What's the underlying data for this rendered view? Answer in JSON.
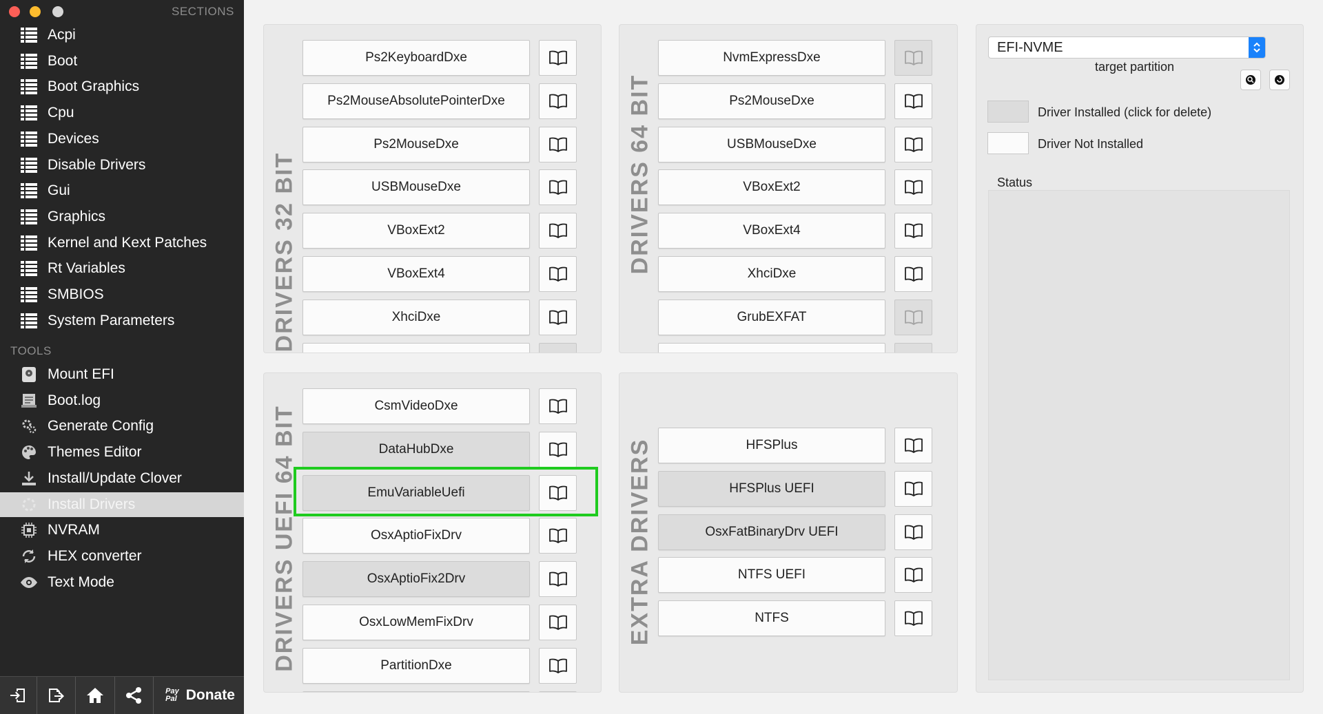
{
  "sidebar": {
    "sections_title": "SECTIONS",
    "sections": [
      {
        "label": "Acpi",
        "icon": "list-icon"
      },
      {
        "label": "Boot",
        "icon": "list-icon"
      },
      {
        "label": "Boot Graphics",
        "icon": "list-icon"
      },
      {
        "label": "Cpu",
        "icon": "list-icon"
      },
      {
        "label": "Devices",
        "icon": "list-icon"
      },
      {
        "label": "Disable Drivers",
        "icon": "list-icon"
      },
      {
        "label": "Gui",
        "icon": "list-icon"
      },
      {
        "label": "Graphics",
        "icon": "list-icon"
      },
      {
        "label": "Kernel and Kext Patches",
        "icon": "list-icon"
      },
      {
        "label": "Rt Variables",
        "icon": "list-icon"
      },
      {
        "label": "SMBIOS",
        "icon": "list-icon"
      },
      {
        "label": "System Parameters",
        "icon": "list-icon"
      }
    ],
    "tools_title": "TOOLS",
    "tools": [
      {
        "label": "Mount EFI",
        "icon": "disk-icon"
      },
      {
        "label": "Boot.log",
        "icon": "log-icon"
      },
      {
        "label": "Generate Config",
        "icon": "gear-icon"
      },
      {
        "label": "Themes Editor",
        "icon": "palette-icon"
      },
      {
        "label": "Install/Update Clover",
        "icon": "download-icon"
      },
      {
        "label": "Install Drivers",
        "icon": "drivers-icon",
        "selected": true
      },
      {
        "label": "NVRAM",
        "icon": "chip-icon"
      },
      {
        "label": "HEX converter",
        "icon": "refresh-icon"
      },
      {
        "label": "Text Mode",
        "icon": "eye-icon"
      }
    ],
    "bottom": {
      "donate_label": "Donate",
      "paypal_line1": "Pay",
      "paypal_line2": "Pal"
    }
  },
  "panels": {
    "drivers32": {
      "title": "DRIVERS 32 BIT",
      "items": [
        {
          "label": "Ps2KeyboardDxe",
          "installed": false,
          "doc": true
        },
        {
          "label": "Ps2MouseAbsolutePointerDxe",
          "installed": false,
          "doc": true
        },
        {
          "label": "Ps2MouseDxe",
          "installed": false,
          "doc": true
        },
        {
          "label": "USBMouseDxe",
          "installed": false,
          "doc": true
        },
        {
          "label": "VBoxExt2",
          "installed": false,
          "doc": true
        },
        {
          "label": "VBoxExt4",
          "installed": false,
          "doc": true
        },
        {
          "label": "XhciDxe",
          "installed": false,
          "doc": true
        }
      ]
    },
    "drivers64": {
      "title": "DRIVERS 64 BIT",
      "items": [
        {
          "label": "NvmExpressDxe",
          "installed": false,
          "doc": false
        },
        {
          "label": "Ps2MouseDxe",
          "installed": false,
          "doc": true
        },
        {
          "label": "USBMouseDxe",
          "installed": false,
          "doc": true
        },
        {
          "label": "VBoxExt2",
          "installed": false,
          "doc": true
        },
        {
          "label": "VBoxExt4",
          "installed": false,
          "doc": true
        },
        {
          "label": "XhciDxe",
          "installed": false,
          "doc": true
        },
        {
          "label": "GrubEXFAT",
          "installed": false,
          "doc": false
        }
      ]
    },
    "uefi64": {
      "title": "DRIVERS UEFI 64 BIT",
      "items": [
        {
          "label": "CsmVideoDxe",
          "installed": false,
          "doc": true
        },
        {
          "label": "DataHubDxe",
          "installed": true,
          "doc": true
        },
        {
          "label": "EmuVariableUefi",
          "installed": true,
          "doc": true
        },
        {
          "label": "OsxAptioFixDrv",
          "installed": false,
          "doc": true
        },
        {
          "label": "OsxAptioFix2Drv",
          "installed": true,
          "doc": true
        },
        {
          "label": "OsxLowMemFixDrv",
          "installed": false,
          "doc": true
        },
        {
          "label": "PartitionDxe",
          "installed": false,
          "doc": true
        }
      ]
    },
    "extra": {
      "title": "EXTRA DRIVERS",
      "items": [
        {
          "label": "HFSPlus",
          "installed": false,
          "doc": true
        },
        {
          "label": "HFSPlus UEFI",
          "installed": true,
          "doc": true
        },
        {
          "label": "OsxFatBinaryDrv UEFI",
          "installed": true,
          "doc": true
        },
        {
          "label": "NTFS UEFI",
          "installed": false,
          "doc": true
        },
        {
          "label": "NTFS",
          "installed": false,
          "doc": true
        }
      ]
    }
  },
  "right": {
    "partition_value": "EFI-NVME",
    "partition_caption": "target partition",
    "legend_installed": "Driver Installed (click for delete)",
    "legend_not_installed": "Driver Not Installed",
    "status_label": "Status"
  },
  "colors": {
    "highlight": "#1fcb1f",
    "accent": "#1a82fb",
    "installed_bg": "#dcdcdc"
  }
}
